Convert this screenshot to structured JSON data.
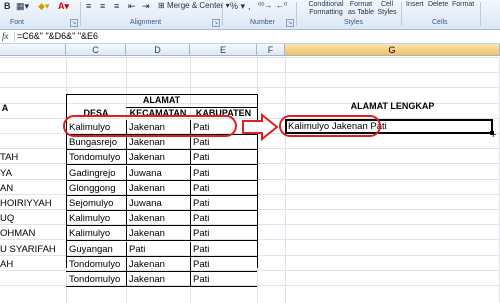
{
  "ribbon": {
    "groups": [
      {
        "label": "Font"
      },
      {
        "label": "Alignment"
      },
      {
        "label": "Number"
      },
      {
        "label": "Styles"
      },
      {
        "label": "Cells"
      }
    ],
    "buttons": {
      "merge_center": "Merge & Center",
      "percent": "%",
      "comma": ",",
      "conditional_formatting": "Conditional Formatting",
      "format_as_table": "Format as Table",
      "cell_styles": "Cell Styles",
      "insert": "Insert",
      "delete": "Delete",
      "format": "Format"
    }
  },
  "formula_bar": {
    "fx": "fx",
    "formula": "=C6&\" \"&D6&\" \"&E6"
  },
  "columns": [
    "C",
    "D",
    "E",
    "F",
    "G"
  ],
  "selected_column": "G",
  "table": {
    "left_header": "A",
    "group_header": "ALAMAT",
    "sub_headers": [
      "DESA",
      "KECAMATAN",
      "KABUPATEN"
    ],
    "names": [
      "",
      "",
      "TAH",
      "YA",
      "AN",
      "HOIRIYYAH",
      "UQ",
      "OHMAN",
      "U SYARIFAH",
      "AH",
      ""
    ],
    "rows": [
      {
        "desa": "Kalimulyo",
        "kecamatan": "Jakenan",
        "kabupaten": "Pati"
      },
      {
        "desa": "Bungasrejo",
        "kecamatan": "Jakenan",
        "kabupaten": "Pati"
      },
      {
        "desa": "Tondomulyo",
        "kecamatan": "Jakenan",
        "kabupaten": "Pati"
      },
      {
        "desa": "Gadingrejo",
        "kecamatan": "Juwana",
        "kabupaten": "Pati"
      },
      {
        "desa": "Glonggong",
        "kecamatan": "Jakenan",
        "kabupaten": "Pati"
      },
      {
        "desa": "Sejomulyo",
        "kecamatan": "Juwana",
        "kabupaten": "Pati"
      },
      {
        "desa": "Kalimulyo",
        "kecamatan": "Jakenan",
        "kabupaten": "Pati"
      },
      {
        "desa": "Kalimulyo",
        "kecamatan": "Jakenan",
        "kabupaten": "Pati"
      },
      {
        "desa": "Guyangan",
        "kecamatan": "Pati",
        "kabupaten": "Pati"
      },
      {
        "desa": "Tondomulyo",
        "kecamatan": "Jakenan",
        "kabupaten": "Pati"
      },
      {
        "desa": "Tondomulyo",
        "kecamatan": "Jakenan",
        "kabupaten": "Pati"
      }
    ]
  },
  "result": {
    "header": "ALAMAT LENGKAP",
    "value": "Kalimulyo Jakenan Pati"
  },
  "colors": {
    "annotation": "#e02020",
    "selection": "#000000"
  }
}
